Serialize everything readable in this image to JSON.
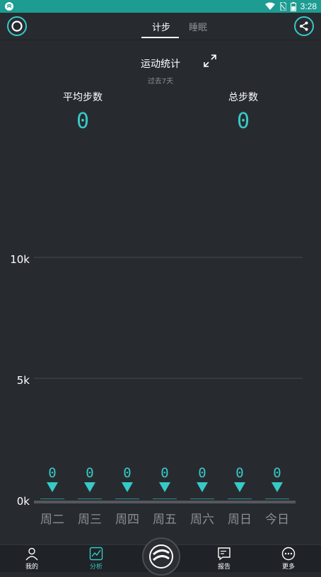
{
  "status": {
    "time": "3:28"
  },
  "tabs": [
    {
      "label": "计步",
      "active": true
    },
    {
      "label": "睡眠",
      "active": false
    }
  ],
  "header": {
    "title": "运动统计",
    "subtitle": "过去7天"
  },
  "stats": {
    "avg_label": "平均步数",
    "avg_value": "0",
    "total_label": "总步数",
    "total_value": "0"
  },
  "chart_data": {
    "type": "bar",
    "categories": [
      "周二",
      "周三",
      "周四",
      "周五",
      "周六",
      "周日",
      "今日"
    ],
    "values": [
      0,
      0,
      0,
      0,
      0,
      0,
      0
    ],
    "ylim": [
      0,
      10000
    ],
    "y_ticks": [
      "10k",
      "5k",
      "0k"
    ],
    "grid": true,
    "colors": {
      "accent": "#37c9c6",
      "grid": "#44494f",
      "label": "#8c9095"
    }
  },
  "bottom_nav": [
    {
      "label": "我的",
      "icon": "person-icon",
      "active": false
    },
    {
      "label": "分析",
      "icon": "chart-icon",
      "active": true
    },
    {
      "label": "报告",
      "icon": "report-icon",
      "active": false
    },
    {
      "label": "更多",
      "icon": "more-icon",
      "active": false
    }
  ],
  "colors": {
    "accent": "#37c9c6",
    "background": "#272b30",
    "statusbar": "#1d9c91"
  }
}
